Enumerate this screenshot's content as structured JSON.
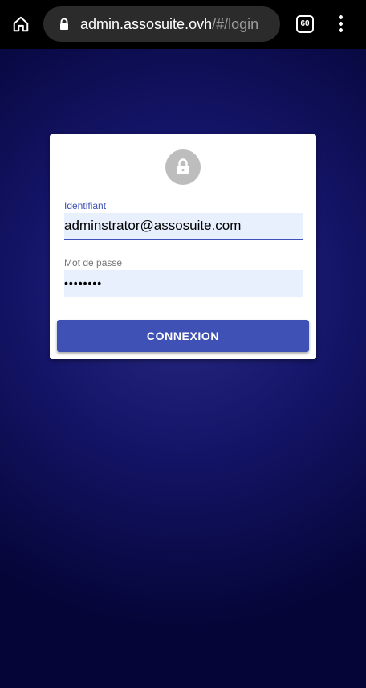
{
  "browser": {
    "url_host": "admin.assosuite.ovh",
    "url_path": "/#/login",
    "tab_count": "60",
    "home_icon": "home-icon",
    "lock_icon": "lock-icon",
    "menu_icon": "more-vert-icon"
  },
  "login": {
    "avatar_icon": "lock-icon",
    "username_label": "Identifiant",
    "username_value": "adminstrator@assosuite.com",
    "password_label": "Mot de passe",
    "password_value": "••••••••",
    "submit_label": "CONNEXION"
  },
  "colors": {
    "primary": "#3f51b5",
    "input_fill": "#e8f0fe",
    "background_dark": "#050538"
  }
}
